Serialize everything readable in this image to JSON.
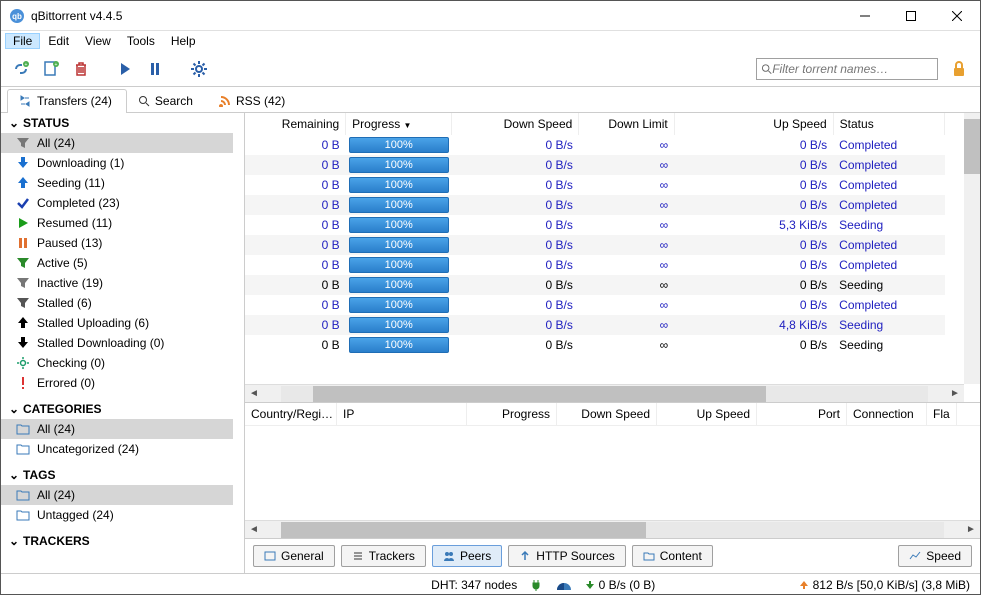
{
  "window": {
    "title": "qBittorrent v4.4.5"
  },
  "menu": {
    "file": "File",
    "edit": "Edit",
    "view": "View",
    "tools": "Tools",
    "help": "Help"
  },
  "filter": {
    "placeholder": "Filter torrent names…"
  },
  "tabs": {
    "transfers": "Transfers (24)",
    "search": "Search",
    "rss": "RSS (42)"
  },
  "sidebar": {
    "status_header": "STATUS",
    "status": [
      {
        "label": "All (24)",
        "icon": "funnel",
        "color": "#777"
      },
      {
        "label": "Downloading (1)",
        "icon": "down",
        "color": "#1a70d0"
      },
      {
        "label": "Seeding (11)",
        "icon": "up",
        "color": "#1a70d0"
      },
      {
        "label": "Completed (23)",
        "icon": "check",
        "color": "#1a3fb0"
      },
      {
        "label": "Resumed (11)",
        "icon": "play",
        "color": "#1a9c1a"
      },
      {
        "label": "Paused (13)",
        "icon": "pause",
        "color": "#e07030"
      },
      {
        "label": "Active (5)",
        "icon": "funnel",
        "color": "#2a8a2a"
      },
      {
        "label": "Inactive (19)",
        "icon": "funnel",
        "color": "#777"
      },
      {
        "label": "Stalled (6)",
        "icon": "funnel",
        "color": "#555"
      },
      {
        "label": "Stalled Uploading (6)",
        "icon": "up",
        "color": "#000"
      },
      {
        "label": "Stalled Downloading (0)",
        "icon": "down",
        "color": "#000"
      },
      {
        "label": "Checking (0)",
        "icon": "gear",
        "color": "#1a9c6a"
      },
      {
        "label": "Errored (0)",
        "icon": "bang",
        "color": "#d33"
      }
    ],
    "categories_header": "CATEGORIES",
    "categories": [
      {
        "label": "All (24)"
      },
      {
        "label": "Uncategorized (24)"
      }
    ],
    "tags_header": "TAGS",
    "tags": [
      {
        "label": "All (24)"
      },
      {
        "label": "Untagged (24)"
      }
    ],
    "trackers_header": "TRACKERS"
  },
  "columns": {
    "remaining": "Remaining",
    "progress": "Progress",
    "down_speed": "Down Speed",
    "down_limit": "Down Limit",
    "up_speed": "Up Speed",
    "status": "Status"
  },
  "torrents": [
    {
      "rem": "0 B",
      "prog": "100%",
      "ds": "0 B/s",
      "dl": "∞",
      "us": "0 B/s",
      "st": "Completed",
      "sel": true
    },
    {
      "rem": "0 B",
      "prog": "100%",
      "ds": "0 B/s",
      "dl": "∞",
      "us": "0 B/s",
      "st": "Completed",
      "sel": true
    },
    {
      "rem": "0 B",
      "prog": "100%",
      "ds": "0 B/s",
      "dl": "∞",
      "us": "0 B/s",
      "st": "Completed",
      "sel": true
    },
    {
      "rem": "0 B",
      "prog": "100%",
      "ds": "0 B/s",
      "dl": "∞",
      "us": "0 B/s",
      "st": "Completed",
      "sel": true
    },
    {
      "rem": "0 B",
      "prog": "100%",
      "ds": "0 B/s",
      "dl": "∞",
      "us": "5,3 KiB/s",
      "st": "Seeding",
      "sel": true
    },
    {
      "rem": "0 B",
      "prog": "100%",
      "ds": "0 B/s",
      "dl": "∞",
      "us": "0 B/s",
      "st": "Completed",
      "sel": true
    },
    {
      "rem": "0 B",
      "prog": "100%",
      "ds": "0 B/s",
      "dl": "∞",
      "us": "0 B/s",
      "st": "Completed",
      "sel": true
    },
    {
      "rem": "0 B",
      "prog": "100%",
      "ds": "0 B/s",
      "dl": "∞",
      "us": "0 B/s",
      "st": "Seeding",
      "sel": false
    },
    {
      "rem": "0 B",
      "prog": "100%",
      "ds": "0 B/s",
      "dl": "∞",
      "us": "0 B/s",
      "st": "Completed",
      "sel": true
    },
    {
      "rem": "0 B",
      "prog": "100%",
      "ds": "0 B/s",
      "dl": "∞",
      "us": "4,8 KiB/s",
      "st": "Seeding",
      "sel": true
    },
    {
      "rem": "0 B",
      "prog": "100%",
      "ds": "0 B/s",
      "dl": "∞",
      "us": "0 B/s",
      "st": "Seeding",
      "sel": false
    }
  ],
  "peers_cols": {
    "country": "Country/Regi…",
    "ip": "IP",
    "progress": "Progress",
    "down": "Down Speed",
    "up": "Up Speed",
    "port": "Port",
    "conn": "Connection",
    "flags": "Fla"
  },
  "bottom_tabs": {
    "general": "General",
    "trackers": "Trackers",
    "peers": "Peers",
    "http": "HTTP Sources",
    "content": "Content",
    "speed": "Speed"
  },
  "status_bar": {
    "dht": "DHT: 347 nodes",
    "down": "0 B/s (0 B)",
    "up": "812 B/s [50,0 KiB/s] (3,8 MiB)"
  }
}
